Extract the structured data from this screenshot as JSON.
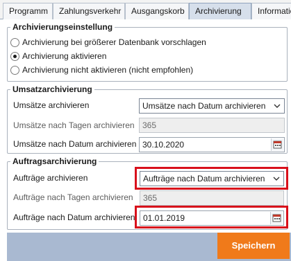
{
  "tabs": [
    {
      "label": "Programm",
      "active": false
    },
    {
      "label": "Zahlungsverkehr",
      "active": false
    },
    {
      "label": "Ausgangskorb",
      "active": false
    },
    {
      "label": "Archivierung",
      "active": true
    },
    {
      "label": "Informatio",
      "active": false
    }
  ],
  "archive_settings": {
    "title": "Archivierungseinstellung",
    "options": [
      {
        "label": "Archivierung bei größerer Datenbank vorschlagen",
        "checked": false
      },
      {
        "label": "Archivierung aktivieren",
        "checked": true
      },
      {
        "label": "Archivierung nicht aktivieren (nicht empfohlen)",
        "checked": false
      }
    ]
  },
  "sales": {
    "title": "Umsatzarchivierung",
    "mode_label": "Umsätze archivieren",
    "mode_value": "Umsätze nach Datum archivieren",
    "days_label": "Umsätze nach Tagen archivieren",
    "days_value": "365",
    "date_label": "Umsätze nach Datum archivieren",
    "date_value": "30.10.2020"
  },
  "orders": {
    "title": "Auftragsarchivierung",
    "mode_label": "Aufträge archivieren",
    "mode_value": "Aufträge nach Datum archivieren",
    "days_label": "Aufträge nach Tagen archivieren",
    "days_value": "365",
    "date_label": "Aufträge nach Datum archivieren",
    "date_value": "01.01.2019"
  },
  "footer": {
    "save_label": "Speichern"
  },
  "colors": {
    "accent": "#f07a1a",
    "highlight": "#d8101b",
    "footer": "#a9b9d1",
    "active_tab": "#d6dfeb"
  }
}
